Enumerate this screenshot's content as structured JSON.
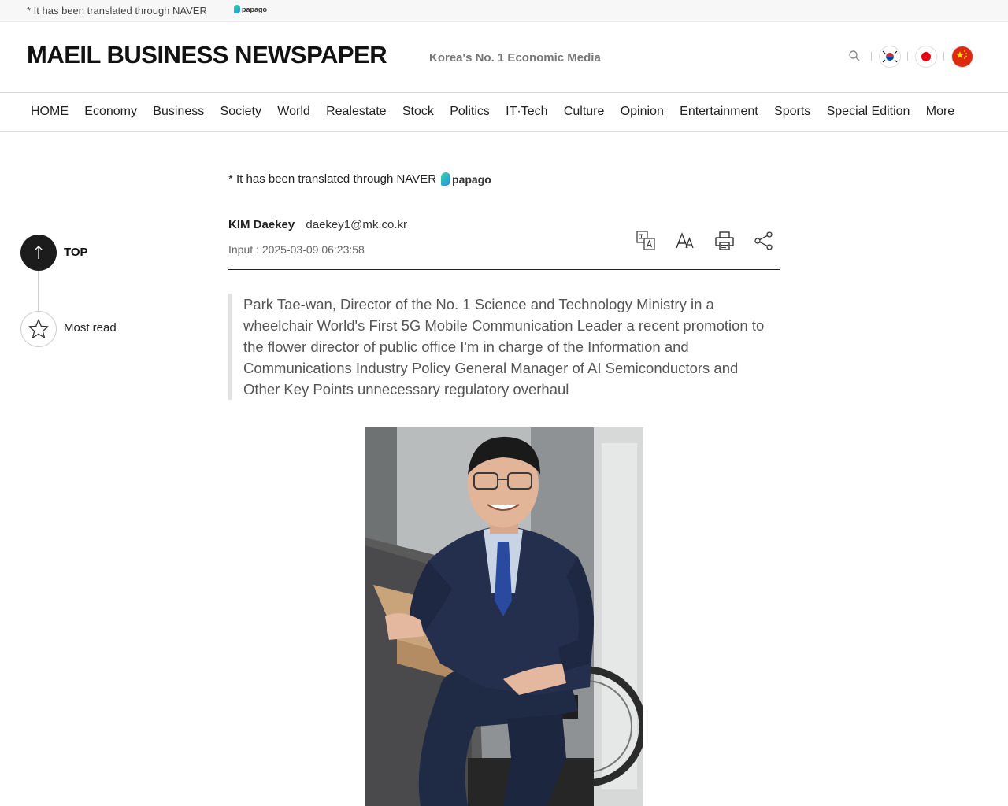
{
  "translation_strip": {
    "text": "* It has been translated through NAVER",
    "papago": "papago"
  },
  "masthead": {
    "logo": "MAEIL BUSINESS NEWSPAPER",
    "tagline": "Korea's No. 1 Economic Media",
    "icons": [
      "search-icon",
      "korea-flag-icon",
      "japan-flag-icon",
      "china-flag-icon"
    ]
  },
  "nav": {
    "items": [
      "HOME",
      "Economy",
      "Business",
      "Society",
      "World",
      "Realestate",
      "Stock",
      "Politics",
      "IT·Tech",
      "Culture",
      "Opinion",
      "Entertainment",
      "Sports",
      "Special Edition",
      "More"
    ]
  },
  "rail": {
    "top_label": "TOP",
    "mostread_label": "Most read"
  },
  "article": {
    "notice": "* It has been translated through NAVER",
    "papago": "papago",
    "author": "KIM Daekey",
    "email": "daekey1@mk.co.kr",
    "input_label": "Input :",
    "input_date": "2025-03-09 06:23:58",
    "tools": [
      "translate-icon",
      "font-size-icon",
      "print-icon",
      "share-icon"
    ],
    "summary": "Park Tae-wan, Director of the No. 1 Science and Technology Ministry in a wheelchair World's First 5G Mobile Communication Leader a recent promotion to the flower director of public office I'm in charge of the Information and Communications Industry Policy General Manager of AI Semiconductors and Other Key Points unnecessary regulatory overhaul"
  }
}
